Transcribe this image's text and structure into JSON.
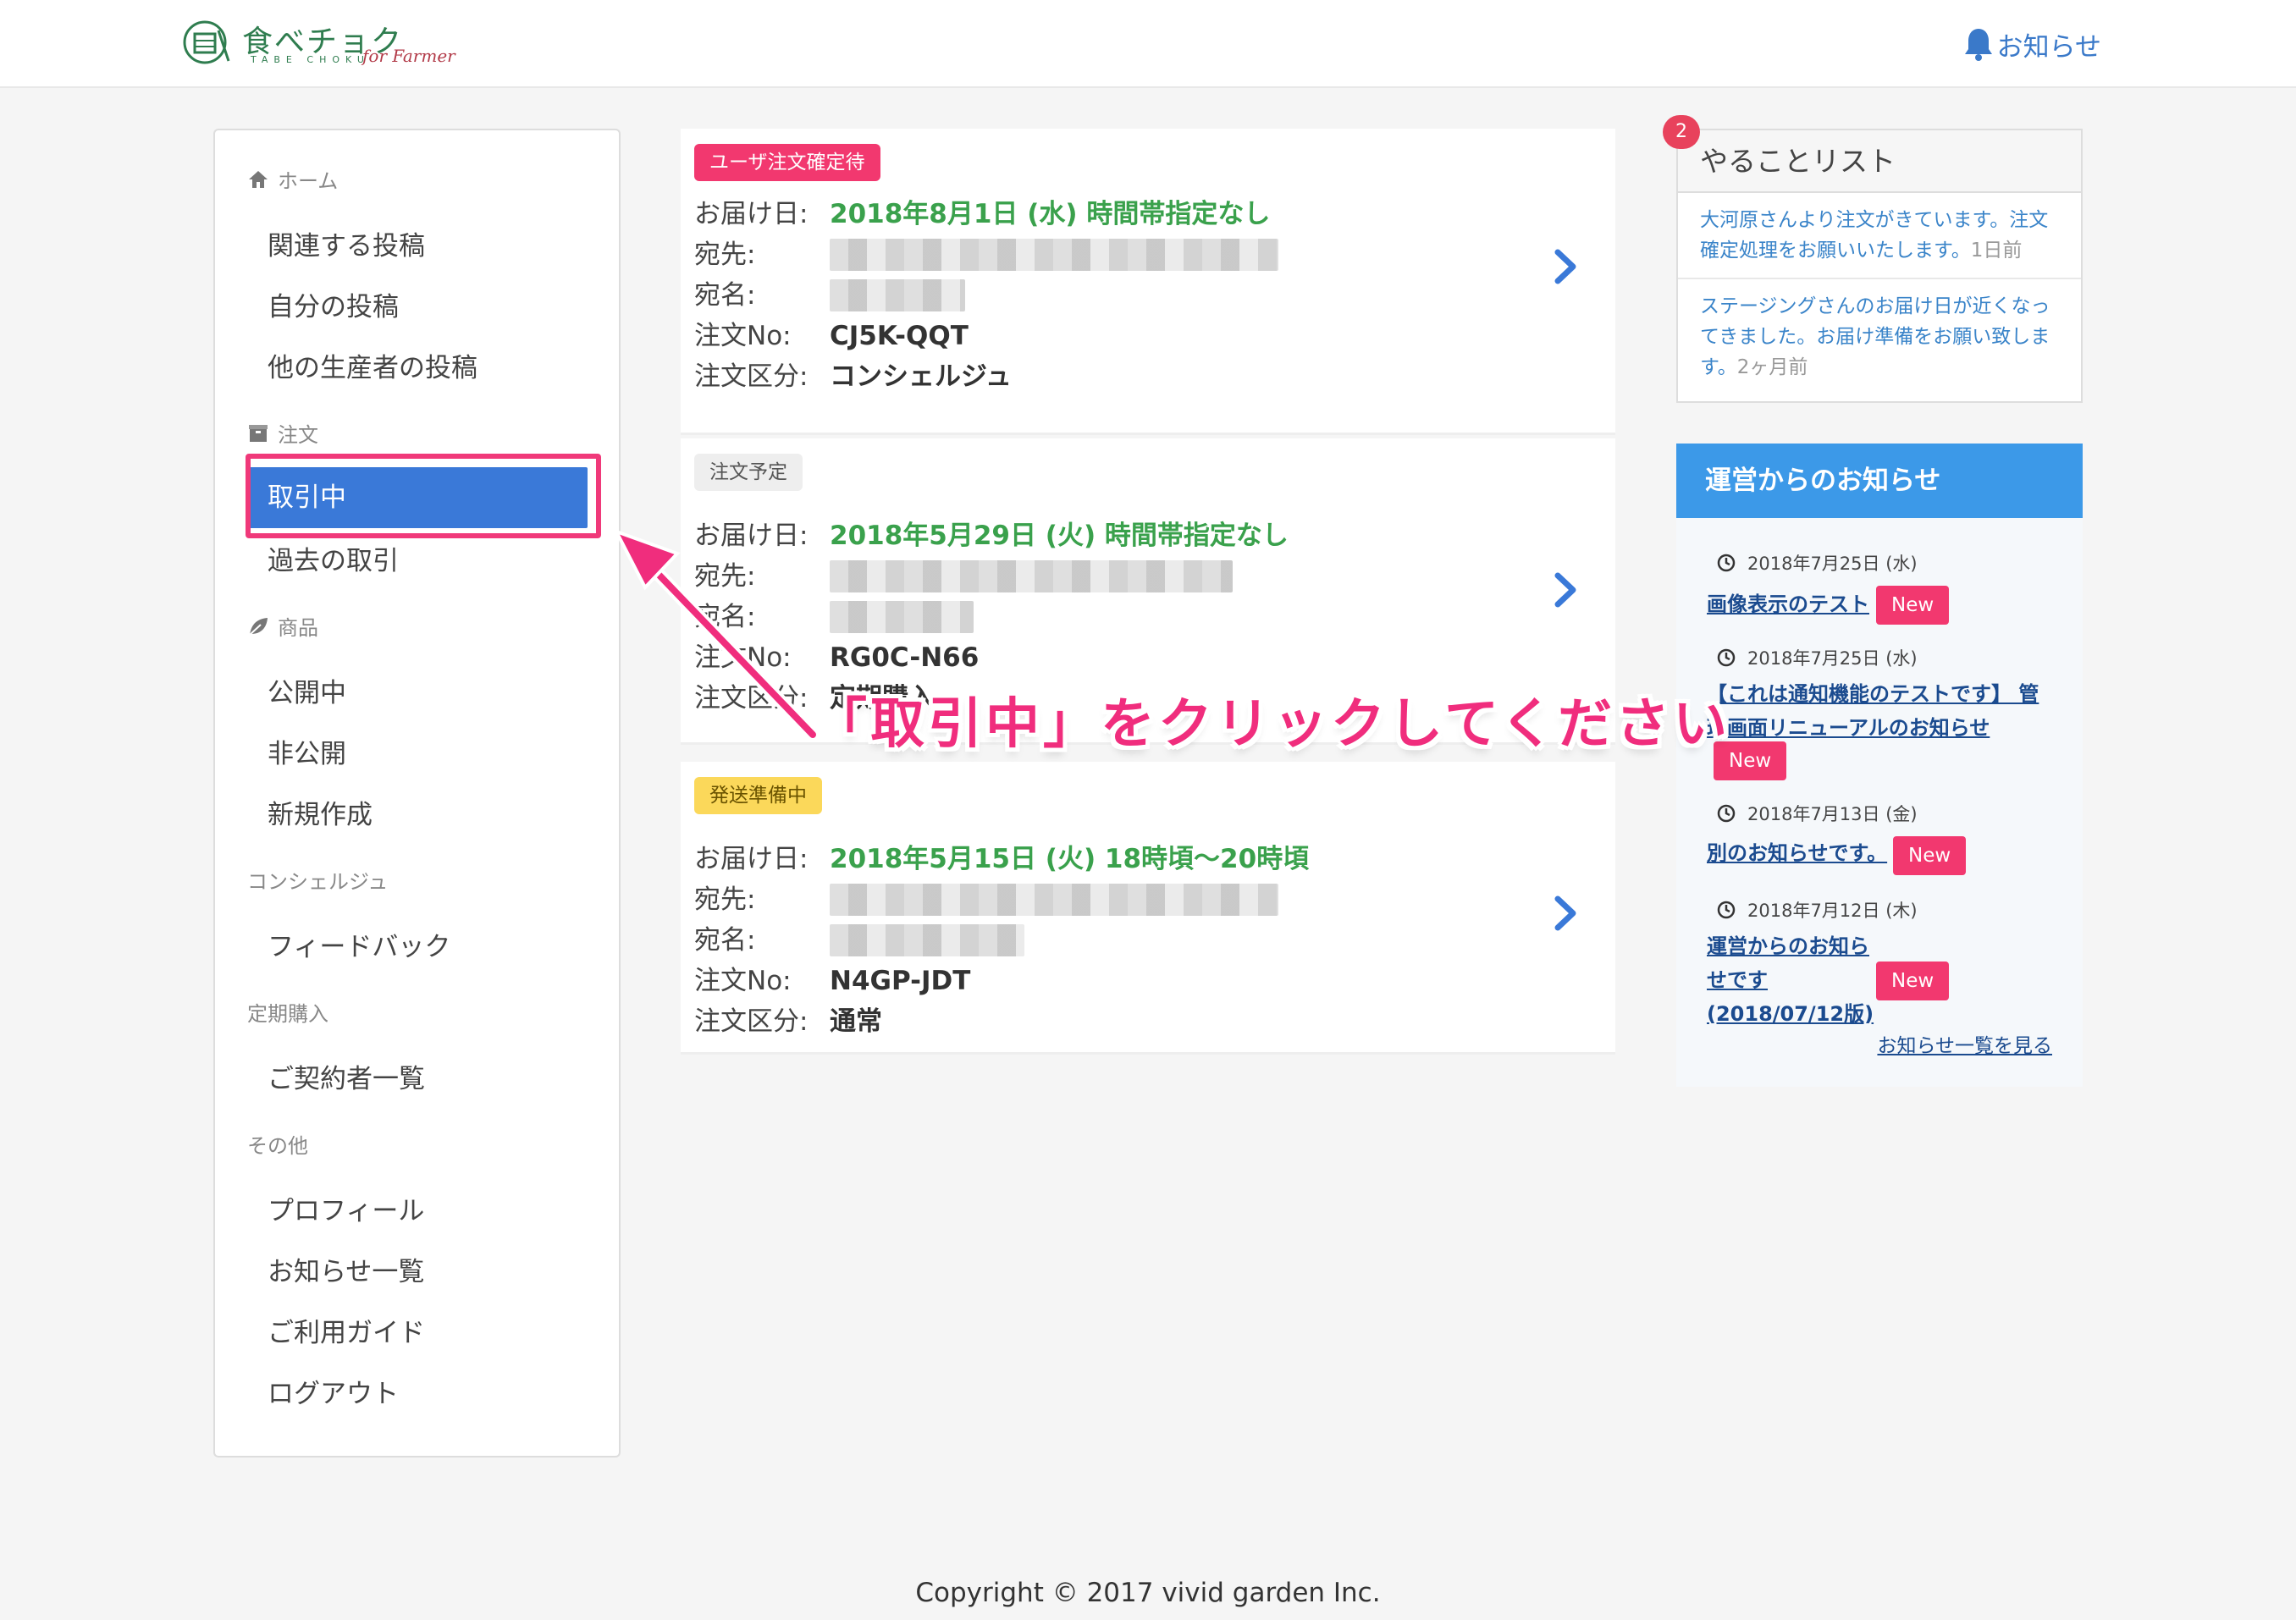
{
  "header": {
    "logo_text": "食べチョク",
    "logo_sub": "TABE CHOKU",
    "logo_script": "for Farmer",
    "notice_label": "お知らせ"
  },
  "sidebar": {
    "sections": [
      {
        "label": "ホーム",
        "icon": "home-icon",
        "items": [
          "関連する投稿",
          "自分の投稿",
          "他の生産者の投稿"
        ]
      },
      {
        "label": "注文",
        "icon": "box-icon",
        "items": [
          "取引中",
          "過去の取引"
        ]
      },
      {
        "label": "商品",
        "icon": "leaf-icon",
        "items": [
          "公開中",
          "非公開",
          "新規作成"
        ]
      },
      {
        "label": "コンシェルジュ",
        "items": [
          "フィードバック"
        ]
      },
      {
        "label": "定期購入",
        "items": [
          "ご契約者一覧"
        ]
      },
      {
        "label": "その他",
        "items": [
          "プロフィール",
          "お知らせ一覧",
          "ご利用ガイド",
          "ログアウト"
        ]
      }
    ],
    "active_item": "取引中"
  },
  "orders": [
    {
      "badge": "ユーザ注文確定待",
      "labels": {
        "date": "お届け日:",
        "address": "宛先:",
        "name": "宛名:",
        "no": "注文No:",
        "type": "注文区分:"
      },
      "date": "2018年8月1日 (水) 時間帯指定なし",
      "order_no": "CJ5K-QQT",
      "order_type": "コンシェルジュ"
    },
    {
      "badge": "注文予定",
      "labels": {
        "date": "お届け日:",
        "address": "宛先:",
        "name": "宛名:",
        "no": "注文No:",
        "type": "注文区分:"
      },
      "date": "2018年5月29日 (火) 時間帯指定なし",
      "order_no": "RG0C-N66",
      "order_type": "定期購入"
    },
    {
      "badge": "発送準備中",
      "labels": {
        "date": "お届け日:",
        "address": "宛先:",
        "name": "宛名:",
        "no": "注文No:",
        "type": "注文区分:"
      },
      "date": "2018年5月15日 (火) 18時頃〜20時頃",
      "order_no": "N4GP-JDT",
      "order_type": "通常"
    }
  ],
  "todo": {
    "title": "やることリスト",
    "count": "2",
    "items": [
      {
        "text": "大河原さんより注文がきています。注文確定処理をお願いいたします。",
        "ago": "1日前"
      },
      {
        "text": "ステージングさんのお届け日が近くなってきました。お届け準備をお願い致します。",
        "ago": "2ヶ月前"
      }
    ]
  },
  "news": {
    "title": "運営からのお知らせ",
    "new_label": "New",
    "items": [
      {
        "date": "2018年7月25日 (水)",
        "title": "画像表示のテスト"
      },
      {
        "date": "2018年7月25日 (水)",
        "title": "【これは通知機能のテストです】 管理画面リニューアルのお知らせ"
      },
      {
        "date": "2018年7月13日 (金)",
        "title": "別のお知らせです。"
      },
      {
        "date": "2018年7月12日 (木)",
        "title": "運営からのお知らせです(2018/07/12版)"
      }
    ],
    "see_all": "お知らせ一覧を見る"
  },
  "annotation": {
    "callout": "「取引中」をクリックしてください",
    "color": "#f02d7d"
  },
  "footer": {
    "copyright": "Copyright © 2017 vivid garden Inc."
  }
}
